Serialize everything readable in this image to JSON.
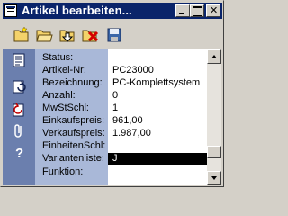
{
  "window": {
    "title": "Artikel bearbeiten...",
    "title_bar_color": "#0a246a"
  },
  "toolbar": {
    "buttons": [
      {
        "name": "new-folder-icon"
      },
      {
        "name": "open-folder-icon"
      },
      {
        "name": "folder-down-arrow-icon"
      },
      {
        "name": "folder-delete-icon"
      },
      {
        "name": "save-disk-icon"
      }
    ]
  },
  "sidebar": {
    "color": "#6b7fae",
    "icons": [
      "list-icon",
      "refresh-icon",
      "undo-icon",
      "attach-icon",
      "help-icon"
    ]
  },
  "fields": [
    {
      "label": "Status:",
      "value": ""
    },
    {
      "label": "Artikel-Nr:",
      "value": "PC23000"
    },
    {
      "label": "Bezeichnung:",
      "value": "PC-Komplettsystem"
    },
    {
      "label": "Anzahl:",
      "value": "0"
    },
    {
      "label": "MwStSchl:",
      "value": "1"
    },
    {
      "label": "Einkaufspreis:",
      "value": "961,00"
    },
    {
      "label": "Verkaufspreis:",
      "value": "1.987,00"
    },
    {
      "label": "EinheitenSchl:",
      "value": ""
    },
    {
      "label": "Variantenliste:",
      "value": "J"
    },
    {
      "label": "Funktion:",
      "value": ""
    }
  ],
  "selected_field": "Variantenliste:"
}
